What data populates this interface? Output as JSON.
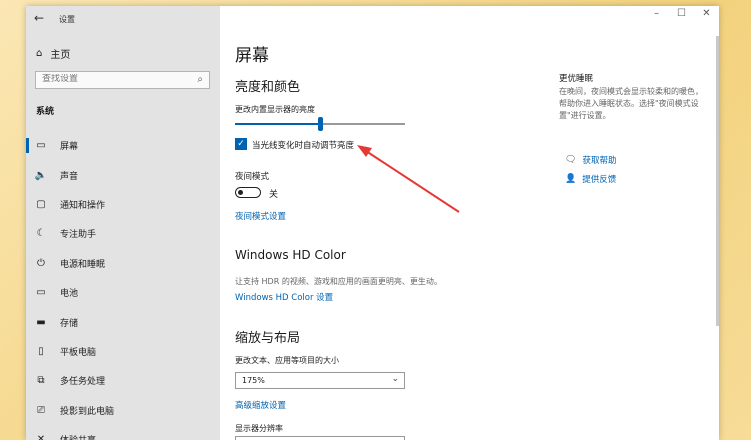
{
  "app": {
    "title": "设置",
    "back_glyph": "←"
  },
  "window_controls": {
    "minimize": "–",
    "maximize": "☐",
    "close": "✕"
  },
  "sidebar": {
    "home_label": "主页",
    "search_placeholder": "查找设置",
    "section_label": "系统",
    "items": [
      {
        "label": "屏幕",
        "icon": "monitor-icon",
        "glyph": "▭",
        "active": true
      },
      {
        "label": "声音",
        "icon": "speaker-icon",
        "glyph": "🔈",
        "active": false
      },
      {
        "label": "通知和操作",
        "icon": "notification-icon",
        "glyph": "▢",
        "active": false
      },
      {
        "label": "专注助手",
        "icon": "moon-icon",
        "glyph": "☾",
        "active": false
      },
      {
        "label": "电源和睡眠",
        "icon": "power-icon",
        "glyph": "⏻",
        "active": false
      },
      {
        "label": "电池",
        "icon": "battery-icon",
        "glyph": "▭",
        "active": false
      },
      {
        "label": "存储",
        "icon": "storage-icon",
        "glyph": "▬",
        "active": false
      },
      {
        "label": "平板电脑",
        "icon": "tablet-icon",
        "glyph": "▯",
        "active": false
      },
      {
        "label": "多任务处理",
        "icon": "multitask-icon",
        "glyph": "⧉",
        "active": false
      },
      {
        "label": "投影到此电脑",
        "icon": "projector-icon",
        "glyph": "⎚",
        "active": false
      },
      {
        "label": "体验共享",
        "icon": "share-icon",
        "glyph": "✕",
        "active": false
      }
    ]
  },
  "main": {
    "page_title": "屏幕",
    "brightness": {
      "heading": "亮度和颜色",
      "slider_label": "更改内置显示器的亮度",
      "slider_value": 0.5,
      "auto_checkbox_label": "当光线变化时自动调节亮度",
      "auto_checked": true
    },
    "night_light": {
      "label": "夜间模式",
      "state": "关",
      "settings_link": "夜间模式设置"
    },
    "hd_color": {
      "heading": "Windows HD Color",
      "desc": "让支持 HDR 的视频、游戏和应用的画面更明亮、更生动。",
      "link": "Windows HD Color 设置"
    },
    "scale": {
      "heading": "缩放与布局",
      "size_label": "更改文本、应用等项目的大小",
      "size_value": "175%",
      "advanced_link": "高级缩放设置",
      "resolution_label": "显示器分辨率"
    }
  },
  "right_panel": {
    "title": "更优睡眠",
    "desc": "在晚间，夜间模式会显示较柔和的暖色，帮助你进入睡眠状态。选择\"夜间模式设置\"进行设置。",
    "help_link": "获取帮助",
    "feedback_link": "提供反馈"
  },
  "colors": {
    "accent": "#0063b1",
    "annotation_arrow": "#e53935"
  }
}
